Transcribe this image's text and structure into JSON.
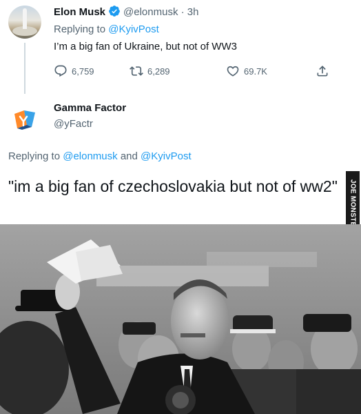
{
  "reply_tweet": {
    "author_name": "Elon Musk",
    "handle": "@elonmusk",
    "separator": "·",
    "time": "3h",
    "replying_prefix": "Replying to",
    "replying_to": "@KyivPost",
    "text": "I’m a big fan of Ukraine, but not of WW3",
    "stats": {
      "replies": "6,759",
      "retweets": "6,289",
      "likes": "69.7K"
    },
    "icons": {
      "reply": "reply-icon",
      "retweet": "retweet-icon",
      "like": "heart-icon",
      "share": "share-icon",
      "verified": "verified-badge-icon"
    },
    "accent_color": "#1d9bf0"
  },
  "quote_tweet": {
    "author_name": "Gamma Factor",
    "handle": "@yFactr",
    "replying_prefix": "Replying to",
    "replying_to_1": "@elonmusk",
    "replying_joiner": "and",
    "replying_to_2": "@KyivPost",
    "text": "\"im a big fan of czechoslovakia but not of ww2\""
  },
  "watermark": {
    "text": "JOE MONSTER"
  },
  "photo": {
    "description_icon": "historical-photo"
  }
}
